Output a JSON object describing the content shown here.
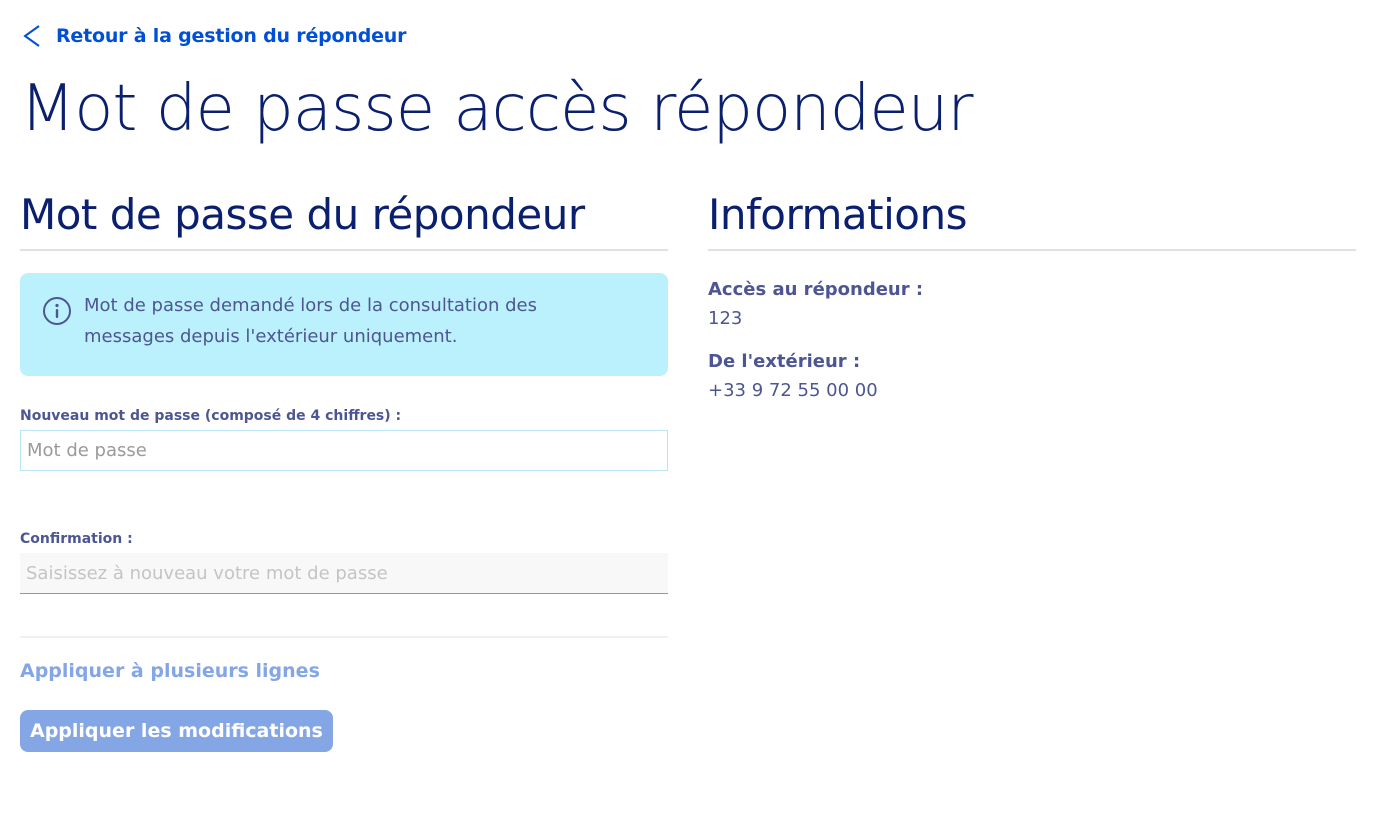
{
  "nav": {
    "back_label": "Retour à la gestion du répondeur"
  },
  "page": {
    "title": "Mot de passe accès répondeur"
  },
  "password_section": {
    "title": "Mot de passe du répondeur",
    "info_text": "Mot de passe demandé lors de la consultation des messages depuis l'extérieur uniquement.",
    "new_password": {
      "label": "Nouveau mot de passe (composé de 4 chiffres) :",
      "placeholder": "Mot de passe",
      "value": ""
    },
    "confirmation": {
      "label": "Confirmation :",
      "placeholder": "Saisissez à nouveau votre mot de passe",
      "value": ""
    },
    "multi_lines_link": "Appliquer à plusieurs lignes",
    "apply_button": "Appliquer les modifications"
  },
  "info_section": {
    "title": "Informations",
    "items": [
      {
        "label": "Accès au répondeur :",
        "value": "123"
      },
      {
        "label": "De l'extérieur :",
        "value": "+33 9 72 55 00 00"
      }
    ]
  },
  "icons": {
    "back": "chevron-left-icon",
    "info": "info-circle-icon"
  },
  "colors": {
    "link": "#0050d7",
    "heading": "#0a1f6d",
    "text": "#4d5693",
    "info_bg": "#bbf0fd",
    "button_disabled": "#85a6e5"
  }
}
